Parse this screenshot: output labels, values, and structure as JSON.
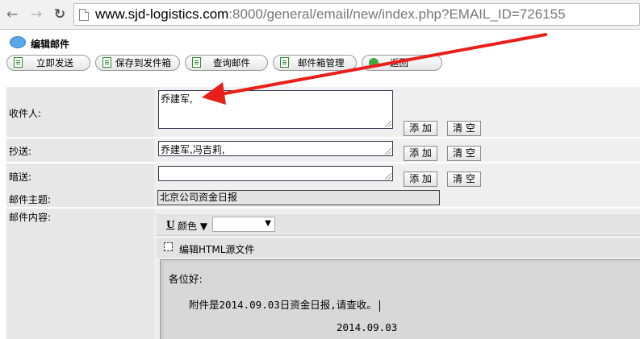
{
  "browser": {
    "url_host": "www.sjd-logistics.com",
    "url_rest": ":8000/general/email/new/index.php?EMAIL_ID=726155"
  },
  "page": {
    "title": "编辑邮件"
  },
  "toolbar": {
    "send_label": "立即发送",
    "save_draft_label": "保存到发件箱",
    "query_label": "查询邮件",
    "mailbox_label": "邮件箱管理",
    "back_label": "返回"
  },
  "form": {
    "to_label": "收件人:",
    "to_value": "乔建军,",
    "cc_label": "抄送:",
    "cc_value": "乔建军,冯吉莉,",
    "bcc_label": "暗送:",
    "bcc_value": "",
    "add_label": "添 加",
    "clear_label": "清 空",
    "subject_label": "邮件主题:",
    "subject_value": "北京公司资金日报",
    "content_label": "邮件内容:"
  },
  "editor": {
    "underline_label": "U",
    "color_label": "颜色",
    "color_arrow": "▼",
    "select_arrow": "▼",
    "source_label": "编辑HTML源文件",
    "greeting": "各位好:",
    "body_text": "附件是2014.09.03日资金日报,请查收。",
    "date_text": "2014.09.03"
  },
  "annotation": {
    "arrow_color": "#e8201a"
  }
}
